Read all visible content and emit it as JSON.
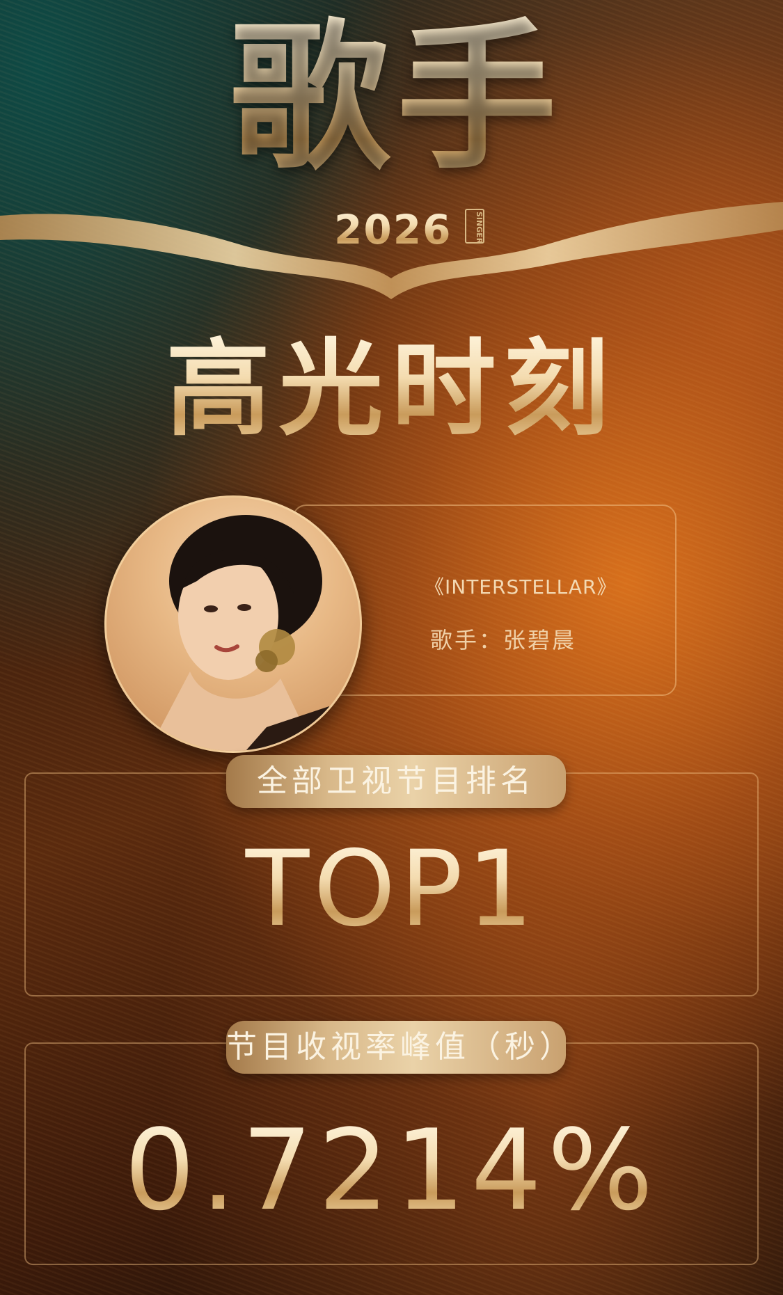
{
  "logo": {
    "title": "歌手",
    "year": "2026",
    "badge": "SINGER"
  },
  "headline": "高光时刻",
  "performance": {
    "song": "《INTERSTELLAR》",
    "singer_line": "歌手：张碧晨"
  },
  "stats": [
    {
      "label": "全部卫视节目排名",
      "value": "TOP1"
    },
    {
      "label": "节目收视率峰值（秒）",
      "value": "0.7214%"
    }
  ],
  "colors": {
    "gold": "#e9cfa2",
    "accent_orange": "#d8742a",
    "dark_bg": "#2a160a"
  }
}
